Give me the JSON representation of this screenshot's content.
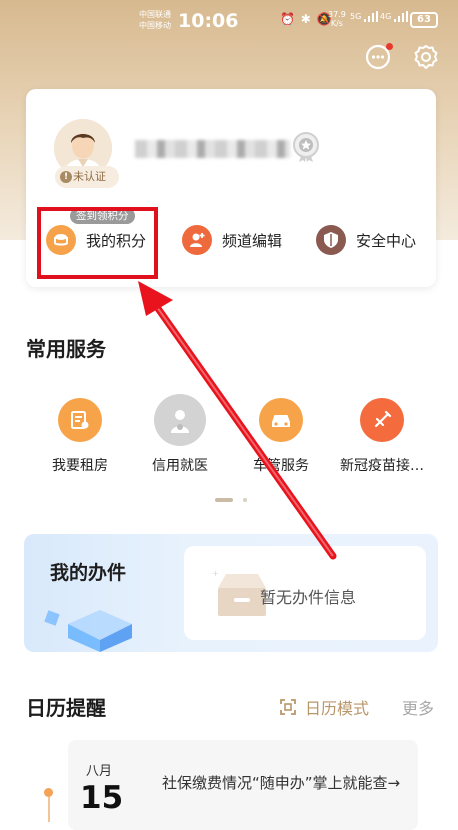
{
  "status_bar": {
    "carrier_1": "中国联通",
    "carrier_2": "中国移动",
    "time": "10:06",
    "net_speed_value": "37.9",
    "net_speed_unit": "K/s",
    "net_type_1": "5G",
    "net_type_2": "4G",
    "battery": "63"
  },
  "profile": {
    "verify_status": "未认证"
  },
  "quick_actions": {
    "sign_tag": "签到领积分",
    "items": [
      {
        "label": "我的积分",
        "icon": "points-icon",
        "color": "#f6a24a"
      },
      {
        "label": "频道编辑",
        "icon": "add-user-icon",
        "color": "#ee6a3c"
      },
      {
        "label": "安全中心",
        "icon": "shield-icon",
        "color": "#8a5a50"
      }
    ]
  },
  "services": {
    "title": "常用服务",
    "items": [
      {
        "label": "我要租房",
        "icon": "rent-house-icon",
        "color": "#f7a34a"
      },
      {
        "label": "信用就医",
        "icon": "credit-medical-icon",
        "color": "#d3d3d3"
      },
      {
        "label": "车管服务",
        "icon": "car-service-icon",
        "color": "#f7a34a"
      },
      {
        "label": "新冠疫苗接…",
        "icon": "vaccine-icon",
        "color": "#f46b3d"
      }
    ]
  },
  "my_affairs": {
    "title": "我的办件",
    "empty_text": "暂无办件信息"
  },
  "calendar": {
    "title": "日历提醒",
    "mode_label": "日历模式",
    "more_label": "更多",
    "month": "八月",
    "day": "15",
    "event_text": "社保缴费情况“随申办”掌上就能查→"
  }
}
